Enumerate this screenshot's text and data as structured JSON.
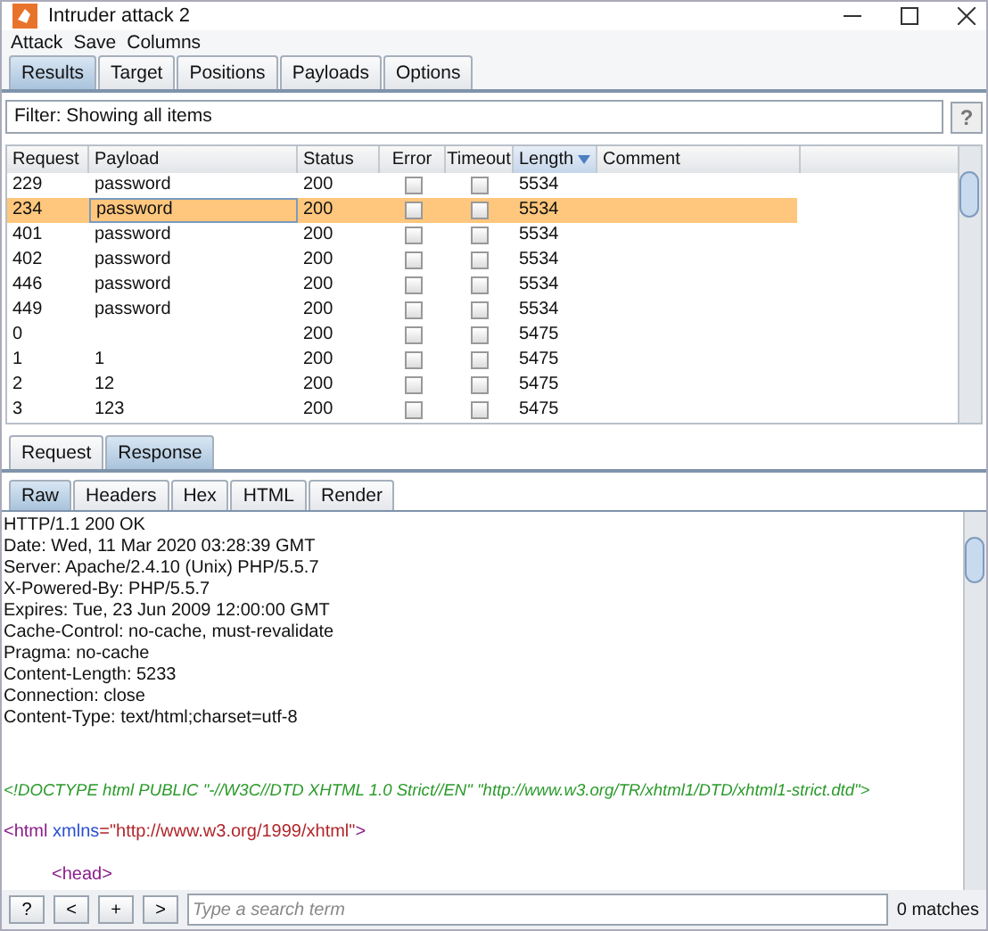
{
  "window": {
    "title": "Intruder attack 2"
  },
  "menu": [
    "Attack",
    "Save",
    "Columns"
  ],
  "tabs": [
    {
      "label": "Results",
      "selected": true
    },
    {
      "label": "Target",
      "selected": false
    },
    {
      "label": "Positions",
      "selected": false
    },
    {
      "label": "Payloads",
      "selected": false
    },
    {
      "label": "Options",
      "selected": false
    }
  ],
  "filter": {
    "text": "Filter: Showing all items",
    "help": "?"
  },
  "table": {
    "columns": [
      {
        "label": "Request",
        "sorted": false
      },
      {
        "label": "Payload",
        "sorted": false
      },
      {
        "label": "Status",
        "sorted": false
      },
      {
        "label": "Error",
        "sorted": false
      },
      {
        "label": "Timeout",
        "sorted": false
      },
      {
        "label": "Length",
        "sorted": true
      },
      {
        "label": "Comment",
        "sorted": false
      }
    ],
    "rows": [
      {
        "request": "229",
        "payload": "password",
        "status": "200",
        "error": false,
        "timeout": false,
        "length": "5534",
        "selected": false
      },
      {
        "request": "234",
        "payload": "password",
        "status": "200",
        "error": false,
        "timeout": false,
        "length": "5534",
        "selected": true
      },
      {
        "request": "401",
        "payload": "password",
        "status": "200",
        "error": false,
        "timeout": false,
        "length": "5534",
        "selected": false
      },
      {
        "request": "402",
        "payload": "password",
        "status": "200",
        "error": false,
        "timeout": false,
        "length": "5534",
        "selected": false
      },
      {
        "request": "446",
        "payload": "password",
        "status": "200",
        "error": false,
        "timeout": false,
        "length": "5534",
        "selected": false
      },
      {
        "request": "449",
        "payload": "password",
        "status": "200",
        "error": false,
        "timeout": false,
        "length": "5534",
        "selected": false
      },
      {
        "request": "0",
        "status": "200",
        "error": false,
        "timeout": false,
        "length": "5475",
        "selected": false
      },
      {
        "request": "1",
        "payload": "1",
        "status": "200",
        "error": false,
        "timeout": false,
        "length": "5475",
        "selected": false
      },
      {
        "request": "2",
        "payload": "12",
        "status": "200",
        "error": false,
        "timeout": false,
        "length": "5475",
        "selected": false
      },
      {
        "request": "3",
        "payload": "123",
        "status": "200",
        "error": false,
        "timeout": false,
        "length": "5475",
        "selected": false
      }
    ]
  },
  "message_tabs": [
    {
      "label": "Request",
      "selected": false
    },
    {
      "label": "Response",
      "selected": true
    }
  ],
  "view_tabs": [
    {
      "label": "Raw",
      "selected": true
    },
    {
      "label": "Headers",
      "selected": false
    },
    {
      "label": "Hex",
      "selected": false
    },
    {
      "label": "HTML",
      "selected": false
    },
    {
      "label": "Render",
      "selected": false
    }
  ],
  "response_lines": [
    {
      "kind": "text",
      "text": "HTTP/1.1 200 OK"
    },
    {
      "kind": "text",
      "text": "Date: Wed, 11 Mar 2020 03:28:39 GMT"
    },
    {
      "kind": "text",
      "text": "Server: Apache/2.4.10 (Unix) PHP/5.5.7"
    },
    {
      "kind": "text",
      "text": "X-Powered-By: PHP/5.5.7"
    },
    {
      "kind": "text",
      "text": "Expires: Tue, 23 Jun 2009 12:00:00 GMT"
    },
    {
      "kind": "text",
      "text": "Cache-Control: no-cache, must-revalidate"
    },
    {
      "kind": "text",
      "text": "Pragma: no-cache"
    },
    {
      "kind": "text",
      "text": "Content-Length: 5233"
    },
    {
      "kind": "text",
      "text": "Connection: close"
    },
    {
      "kind": "text",
      "text": "Content-Type: text/html;charset=utf-8"
    },
    {
      "kind": "doctype",
      "text": "<!DOCTYPE html PUBLIC \"-//W3C//DTD XHTML 1.0 Strict//EN\" \"http://www.w3.org/TR/xhtml1/DTD/xhtml1-strict.dtd\">"
    },
    {
      "kind": "html",
      "tag": "<html",
      "attr": "xmlns",
      "value": "=\"http://www.w3.org/1999/xhtml\"",
      "close": ">"
    },
    {
      "kind": "tag",
      "text": "<head>"
    }
  ],
  "search": {
    "buttons": [
      "?",
      "<",
      "+",
      ">"
    ],
    "placeholder": "Type a search term",
    "matches": "0 matches"
  }
}
